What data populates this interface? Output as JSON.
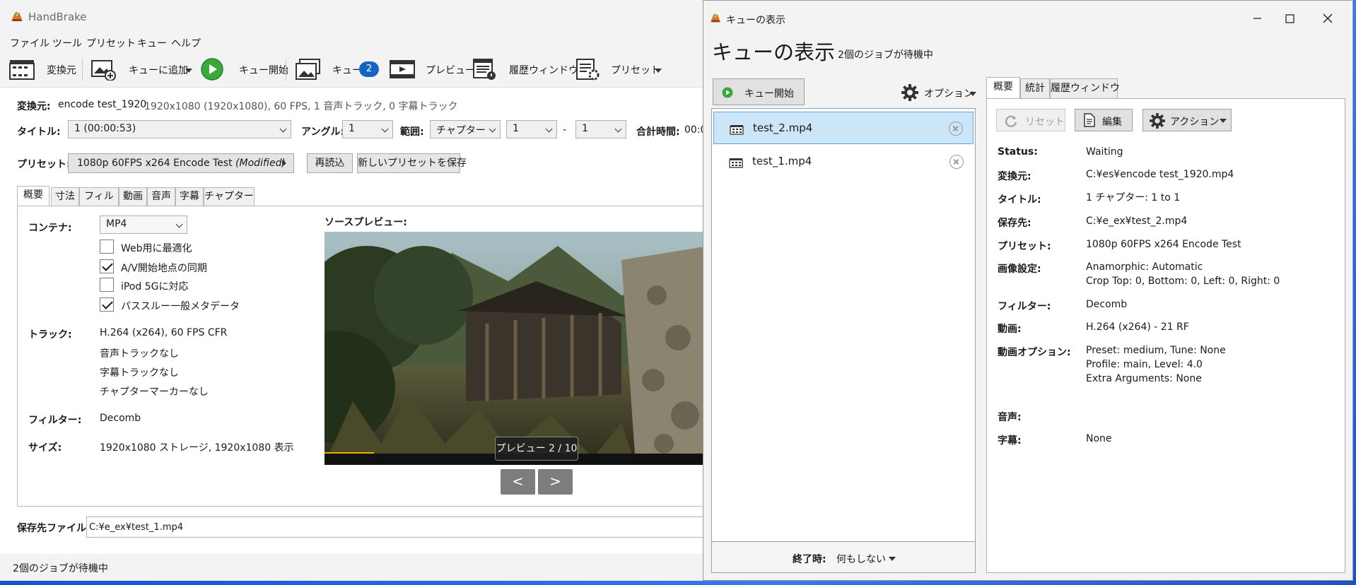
{
  "main": {
    "title": "HandBrake",
    "menu": [
      "ファイル",
      "ツール",
      "プリセット",
      "キュー",
      "ヘルプ"
    ],
    "toolbar": {
      "source": "変換元",
      "add_queue": "キューに追加",
      "start_queue": "キュー開始",
      "queue": "キュー",
      "queue_count": "2",
      "preview": "プレビュー",
      "history": "履歴ウィンドウ",
      "preset": "プリセット"
    },
    "source": {
      "label": "変換元:",
      "name": "encode test_1920",
      "info": "1920x1080 (1920x1080), 60 FPS, 1 音声トラック, 0 字幕トラック"
    },
    "title_row": {
      "title_label": "タイトル:",
      "title_value": "1  (00:00:53)",
      "angle_label": "アングル:",
      "angle_value": "1",
      "range_label": "範囲:",
      "range_type": "チャプター",
      "range_start": "1",
      "range_dash": "-",
      "range_end": "1",
      "duration_label": "合計時間:",
      "duration_value": "00:0"
    },
    "preset_row": {
      "label": "プリセット:",
      "name": "1080p 60FPS x264 Encode Test",
      "modified": "(Modified)",
      "reload": "再読込",
      "save_new": "新しいプリセットを保存"
    },
    "tabs": [
      "概要",
      "寸法",
      "フィルタ",
      "動画",
      "音声",
      "字幕",
      "チャプター"
    ],
    "summary": {
      "container_label": "コンテナ:",
      "container_value": "MP4",
      "options": [
        {
          "label": "Web用に最適化",
          "checked": false
        },
        {
          "label": "A/V開始地点の同期",
          "checked": true
        },
        {
          "label": "iPod 5Gに対応",
          "checked": false
        },
        {
          "label": "パススルー一般メタデータ",
          "checked": true
        }
      ],
      "tracks_label": "トラック:",
      "tracks": [
        "H.264 (x264), 60 FPS CFR",
        "音声トラックなし",
        "字幕トラックなし",
        "チャプターマーカーなし"
      ],
      "filters_label": "フィルター:",
      "filters_value": "Decomb",
      "size_label": "サイズ:",
      "size_value": "1920x1080 ストレージ, 1920x1080 表示",
      "preview_label": "ソースプレビュー:",
      "preview_counter": "プレビュー 2 / 10",
      "prev": "<",
      "next": ">"
    },
    "destination": {
      "label": "保存先ファイル:",
      "value": "C:¥e_ex¥test_1.mp4"
    },
    "status": "2個のジョブが待機中"
  },
  "queue": {
    "window_title": "キューの表示",
    "heading": "キューの表示",
    "subheading": "2個のジョブが待機中",
    "start_button": "キュー開始",
    "options": "オプション",
    "jobs": [
      "test_2.mp4",
      "test_1.mp4"
    ],
    "when_done_label": "終了時:",
    "when_done_value": "何もしない",
    "tabs": [
      "概要",
      "統計",
      "履歴ウィンドウ"
    ],
    "buttons": {
      "reset": "リセット",
      "edit": "編集",
      "actions": "アクション"
    },
    "details": {
      "status_label": "Status:",
      "status_value": "Waiting",
      "source_label": "変換元:",
      "source_value": "C:¥es¥encode test_1920.mp4",
      "title_label": "タイトル:",
      "title_value": "1   チャプター: 1  to  1",
      "dest_label": "保存先:",
      "dest_value": "C:¥e_ex¥test_2.mp4",
      "preset_label": "プリセット:",
      "preset_value": "1080p 60FPS x264 Encode Test",
      "picture_label": "画像設定:",
      "picture_value_1": "Anamorphic: Automatic",
      "picture_value_2": "Crop Top: 0, Bottom: 0, Left: 0, Right: 0",
      "filters_label": "フィルター:",
      "filters_value": "Decomb",
      "video_label": "動画:",
      "video_value": "H.264 (x264) - 21 RF",
      "video_opts_label": "動画オプション:",
      "video_opts_1": "Preset: medium, Tune: None",
      "video_opts_2": "Profile: main, Level: 4.0",
      "video_opts_3": "Extra Arguments: None",
      "audio_label": "音声:",
      "subtitle_label": "字幕:",
      "subtitle_value": "None"
    }
  },
  "colors": {
    "accent": "#1565c0",
    "selected_row": "#cde6f7",
    "play_green": "#3aa83a"
  }
}
